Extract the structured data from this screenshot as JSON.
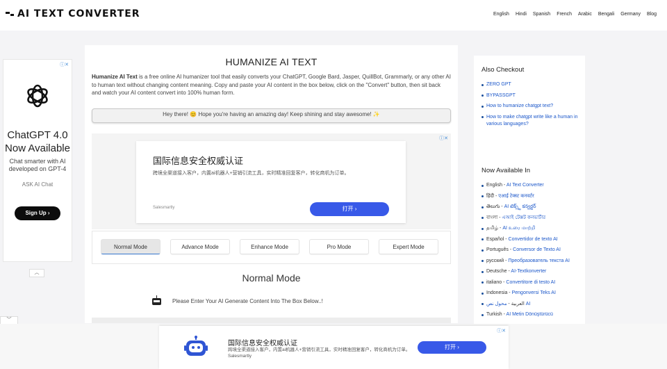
{
  "header": {
    "logo_text": "AI TEXT CONVERTER",
    "nav": [
      "English",
      "Hindi",
      "Spanish",
      "French",
      "Arabic",
      "Bengali",
      "Germany",
      "Blog"
    ]
  },
  "left_ad": {
    "heading": "ChatGPT 4.0 Now Available",
    "text": "Chat smarter with AI developed on GPT-4",
    "ask": "ASK AI Chat",
    "button": "Sign Up ›",
    "collapse": "︿",
    "fold": "﹀"
  },
  "main": {
    "title": "HUMANIZE AI TEXT",
    "intro_bold": "Humanize AI Text",
    "intro": " is a free online AI humanizer tool that easily converts your ChatGPT, Google Bard, Jasper, QuillBot, Grammarly, or any other AI to human text without changing content meaning. Copy and paste your AI content in the box below, click on the \"Convert\" button, then sit back and watch your AI content convert into 100% human form.",
    "greeting": "Hey there! 😊 Hope you're having an amazing day! Keep shining and stay awesome! ✨",
    "modes": [
      "Normal Mode",
      "Advance Mode",
      "Enhance Mode",
      "Pro Mode",
      "Expert Mode"
    ],
    "mode_title": "Normal Mode",
    "prompt": "Please Enter Your AI Generate Content Into The Box Below..!"
  },
  "mid_ad": {
    "title": "国际信息安全权威认证",
    "text": "跨境全渠道接入客户，内置ai机器人+营销引流工具，实时精准回复客户，转化商机为订单。",
    "brand": "Salesmartly",
    "button": "打开 ›"
  },
  "bottom_ad": {
    "title": "国际信息安全权威认证",
    "text": "跨境全渠道接入客户，内置ai机器人+营销引流工具，实时精准回复客户，转化商机为订单。 Salesmartly",
    "button": "打开 ›"
  },
  "sidebar_checkout": {
    "title": "Also Checkout",
    "links": [
      "ZERO GPT",
      "BYPASSGPT",
      "How to humanize chatgpt text?",
      "How to make chatgpt write like a human in various languages?"
    ]
  },
  "sidebar_languages": {
    "title": "Now Available In",
    "items": [
      {
        "lang": "English",
        "link": "AI Text Converter"
      },
      {
        "lang": "हिंदी",
        "link": "एआई टेक्स्ट कनवर्टर"
      },
      {
        "lang": "తెలుగు",
        "link": "AI టెక్స్ట్ కన్వర్టర్"
      },
      {
        "lang": "বাংলা",
        "link": "এআই টেক্সট কনভার্টার"
      },
      {
        "lang": "தமிழ்",
        "link": "AI உரை மாற்றி"
      },
      {
        "lang": "Español",
        "link": "Convertidor de texto AI"
      },
      {
        "lang": "Português",
        "link": "Conversor de Texto AI"
      },
      {
        "lang": "русский",
        "link": "Преобразователь текста AI"
      },
      {
        "lang": "Deutsche",
        "link": "AI-Textkonverter"
      },
      {
        "lang": "italiano",
        "link": "Convertitore di testo AI"
      },
      {
        "lang": "Indonesia",
        "link": "Pengonversi Teks AI"
      },
      {
        "lang": "العربية",
        "link": "محول نص AI"
      },
      {
        "lang": "Turkish",
        "link": "AI Metin Dönüştürücü"
      }
    ]
  },
  "sep": " - "
}
